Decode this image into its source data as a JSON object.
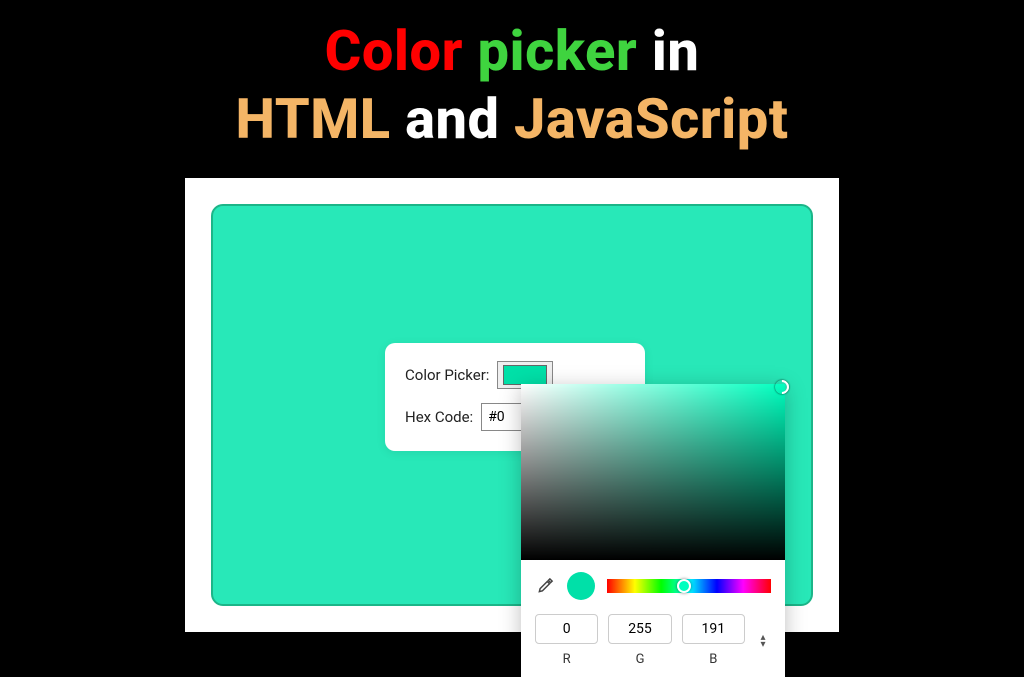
{
  "title": {
    "w1": "Color",
    "w2": "picker",
    "w3": "in",
    "w4": "HTML",
    "w5": "and",
    "w6": "JavaScript"
  },
  "controls": {
    "color_picker_label": "Color Picker:",
    "hex_code_label": "Hex Code:",
    "hex_value_truncated": "#0"
  },
  "picker": {
    "base_hue_color": "#00ffbf",
    "current_color": "#00e0a8",
    "rgb": {
      "r": "0",
      "g": "255",
      "b": "191"
    },
    "labels": {
      "r": "R",
      "g": "G",
      "b": "B"
    }
  },
  "preview_bg": "#28e8b8"
}
